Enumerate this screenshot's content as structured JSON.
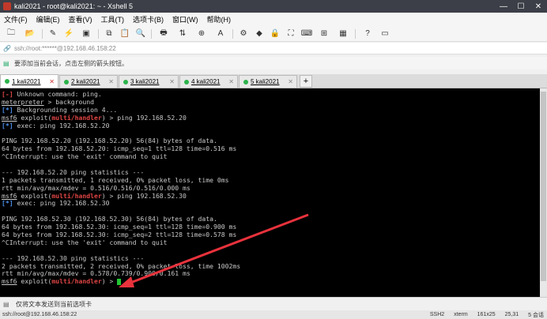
{
  "window": {
    "title": "kali2021 - root@kali2021: ~ - Xshell 5",
    "controls": [
      "—",
      "☐",
      "✕"
    ]
  },
  "menu": [
    "文件(F)",
    "编辑(E)",
    "查看(V)",
    "工具(T)",
    "选项卡(B)",
    "窗口(W)",
    "帮助(H)"
  ],
  "address": {
    "text": "ssh://root:******@192.168.46.158:22"
  },
  "hint": {
    "text": "要添加当前会话，点击左侧的箭头按钮。"
  },
  "tabs": [
    {
      "label": "1 kali2021",
      "active": true
    },
    {
      "label": "2 kali2021",
      "active": false
    },
    {
      "label": "3 kali2021",
      "active": false
    },
    {
      "label": "4 kali2021",
      "active": false
    },
    {
      "label": "5 kali2021",
      "active": false
    }
  ],
  "terminal": {
    "l01": {
      "a": "[-]",
      "b": " Unknown command: ping."
    },
    "l02": {
      "a": "meterpreter",
      "b": " > background"
    },
    "l03": {
      "a": "[*]",
      "b": " Backgrounding session 4..."
    },
    "l04": {
      "a": "msf6",
      "b": " exploit(",
      "c": "multi/handler",
      "d": ") > ping 192.168.52.20"
    },
    "l05": {
      "a": "[*]",
      "b": " exec: ping 192.168.52.20"
    },
    "l06": "",
    "l07": "PING 192.168.52.20 (192.168.52.20) 56(84) bytes of data.",
    "l08": "64 bytes from 192.168.52.20: icmp_seq=1 ttl=128 time=0.516 ms",
    "l09": "^CInterrupt: use the 'exit' command to quit",
    "l10": "",
    "l11": "--- 192.168.52.20 ping statistics ---",
    "l12": "1 packets transmitted, 1 received, 0% packet loss, time 0ms",
    "l13": "rtt min/avg/max/mdev = 0.516/0.516/0.516/0.000 ms",
    "l14": {
      "a": "msf6",
      "b": " exploit(",
      "c": "multi/handler",
      "d": ") > ping 192.168.52.30"
    },
    "l15": {
      "a": "[*]",
      "b": " exec: ping 192.168.52.30"
    },
    "l16": "",
    "l17": "PING 192.168.52.30 (192.168.52.30) 56(84) bytes of data.",
    "l18": "64 bytes from 192.168.52.30: icmp_seq=1 ttl=128 time=0.900 ms",
    "l19": "64 bytes from 192.168.52.30: icmp_seq=2 ttl=128 time=0.578 ms",
    "l20": "^CInterrupt: use the 'exit' command to quit",
    "l21": "",
    "l22": "--- 192.168.52.30 ping statistics ---",
    "l23": "2 packets transmitted, 2 received, 0% packet loss, time 1002ms",
    "l24": "rtt min/avg/max/mdev = 0.578/0.739/0.900/0.161 ms",
    "l25": {
      "a": "msf6",
      "b": " exploit(",
      "c": "multi/handler",
      "d": ") > "
    }
  },
  "send_bar": {
    "text": "仅将文本发送到当前选项卡"
  },
  "status": {
    "left": "ssh://root@192.168.46.158:22",
    "ssh": "SSH2",
    "term": "xterm",
    "size": "161x25",
    "pos": "25,31",
    "sessions": "5 会话"
  },
  "colors": {
    "cursor": "#23c433",
    "error": "#e04545",
    "info": "#4a8ee8",
    "arrow": "#e8323c"
  }
}
